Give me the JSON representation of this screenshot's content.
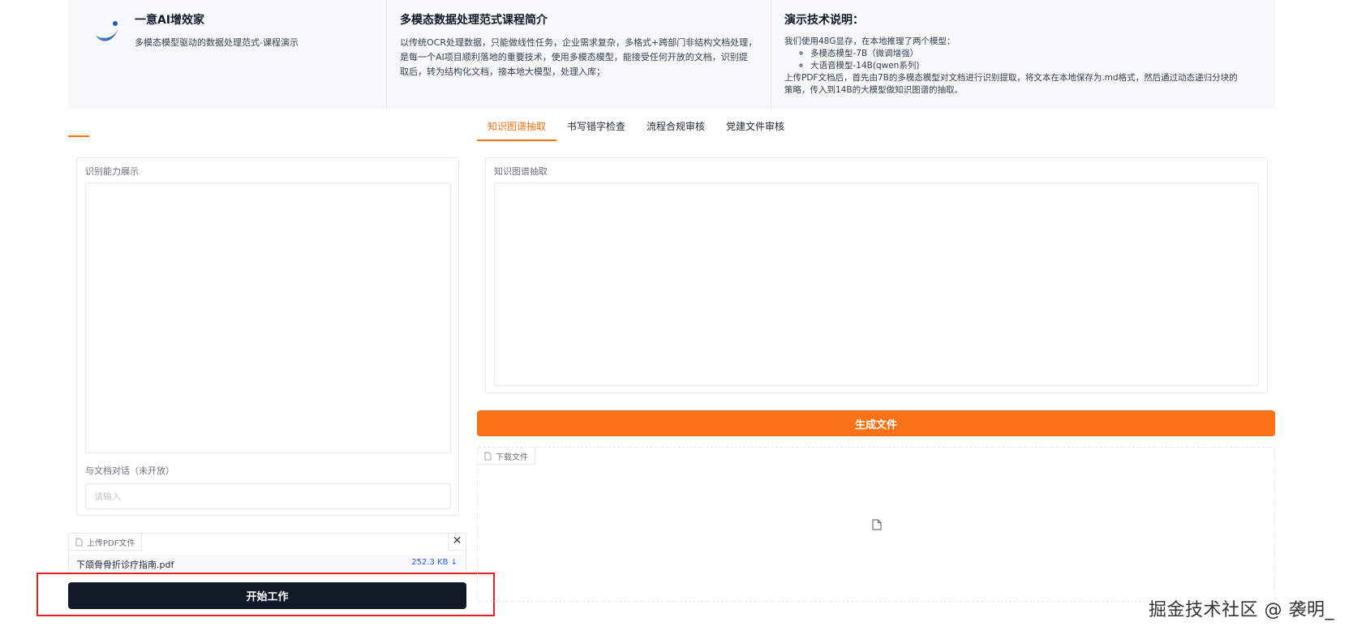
{
  "header": {
    "brand": {
      "title": "一意AI增效家",
      "subtitle": "多模态模型驱动的数据处理范式-课程演示"
    },
    "course": {
      "title": "多模态数据处理范式课程简介",
      "lines": [
        "以传统OCR处理数据，只能做线性任务，企业需求复杂，多格式+跨部门非结构文档处理，",
        "是每一个AI项目顺利落地的重要技术，使用多模态模型，能接受任何开放的文档，识别提",
        "取后，转为结构化文档，接本地大模型，处理入库；"
      ]
    },
    "tech": {
      "title": "演示技术说明：",
      "intro": "我们使用48G显存，在本地推理了两个模型：",
      "models": [
        "多模态模型-7B（微调增强）",
        "大语音模型-14B(qwen系列)"
      ],
      "desc_lines": [
        "上传PDF文档后，首先由7B的多模态模型对文档进行识别提取，将文本在本地保存为.md格式，然后通过动态递归分块的",
        "策略，传入到14B的大模型做知识图谱的抽取。"
      ]
    }
  },
  "tabs": [
    "知识图谱抽取",
    "书写错字检查",
    "流程合规审核",
    "党建文件审核"
  ],
  "active_tab": 0,
  "left": {
    "recognition_label": "识别能力展示",
    "chat_label": "与文档对话（未开放）",
    "chat_placeholder": "请输入"
  },
  "upload": {
    "label": "上传PDF文件",
    "close": "✕",
    "file_name": "下颌骨骨折诊疗指南.pdf",
    "file_size": "252.3 KB ↓"
  },
  "start_button": "开始工作",
  "right": {
    "kg_label": "知识图谱抽取",
    "generate_button": "生成文件",
    "download_label": "下载文件"
  },
  "watermark": "掘金技术社区 @ 袭明_",
  "colors": {
    "accent": "#f97316",
    "dark_button": "#111827",
    "highlight": "#dc2626",
    "link": "#2563eb"
  }
}
